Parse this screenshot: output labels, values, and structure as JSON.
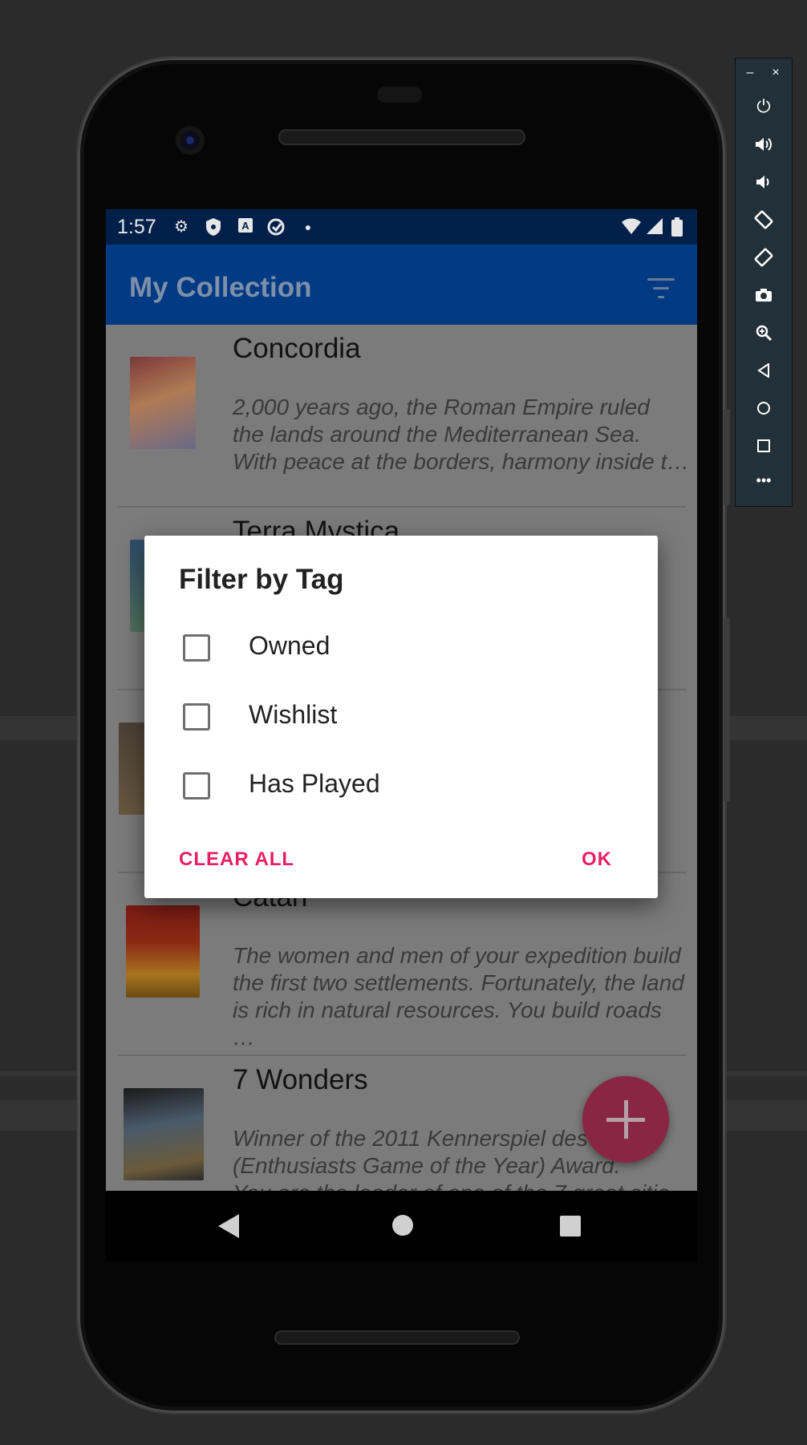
{
  "status_bar": {
    "time": "1:57"
  },
  "app_bar": {
    "title": "My Collection"
  },
  "list": {
    "items": [
      {
        "title": "Concordia",
        "description": "2,000 years ago, the Roman Empire ruled\nthe lands around the Mediterranean Sea.\nWith peace at the borders, harmony inside t…"
      },
      {
        "title": "Terra Mystica",
        "description": ""
      },
      {
        "title": "",
        "description": ""
      },
      {
        "title": "Catan",
        "description": "The women and men of your expedition build\nthe first two settlements. Fortunately, the land\nis rich in natural resources. You build roads …"
      },
      {
        "title": "7 Wonders",
        "description": "Winner of the 2011 Kennerspiel des\n(Enthusiasts Game of the Year) Award.\nYou are the leader of one of the 7 great citie"
      }
    ]
  },
  "dialog": {
    "title": "Filter by Tag",
    "options": [
      {
        "label": "Owned",
        "checked": false
      },
      {
        "label": "Wishlist",
        "checked": false
      },
      {
        "label": "Has Played",
        "checked": false
      }
    ],
    "clear_label": "CLEAR ALL",
    "ok_label": "OK"
  },
  "colors": {
    "accent": "#e91e63",
    "app_bar": "#023a84",
    "status_bar": "#00204a",
    "fab": "#8a2645"
  },
  "icons": {
    "status": [
      "gear-icon",
      "shield-icon",
      "a-icon",
      "sync-icon",
      "dot-icon",
      "wifi-icon",
      "signal-icon",
      "battery-icon"
    ],
    "emulator_panel": [
      "minimize-icon",
      "close-icon",
      "power-icon",
      "volume-up-icon",
      "volume-down-icon",
      "rotate-left-icon",
      "rotate-right-icon",
      "camera-icon",
      "zoom-icon",
      "back-icon",
      "home-icon",
      "overview-icon",
      "more-icon"
    ]
  }
}
